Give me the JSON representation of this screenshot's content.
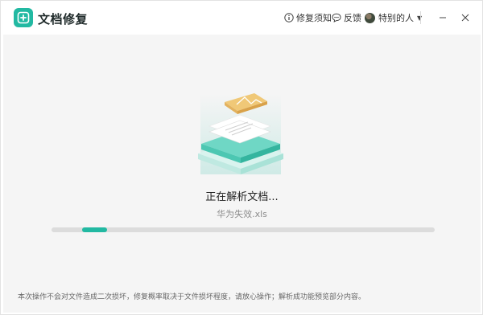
{
  "app": {
    "title": "文档修复",
    "accent": "#22b9a2"
  },
  "titlebar": {
    "help_label": "修复须知",
    "feedback_label": "反馈",
    "user_name": "特别的人",
    "icons": [
      "info-icon",
      "chat-icon",
      "avatar",
      "chevron-down-icon",
      "minimize-icon",
      "close-icon"
    ]
  },
  "main": {
    "status_text": "正在解析文档...",
    "file_name": "华为失效.xls",
    "progress": {
      "start": 0.08,
      "end": 0.145
    }
  },
  "footer": {
    "note": "本次操作不会对文件造成二次损坏，修复概率取决于文件损坏程度，请放心操作；解析成功能预览部分内容。"
  }
}
